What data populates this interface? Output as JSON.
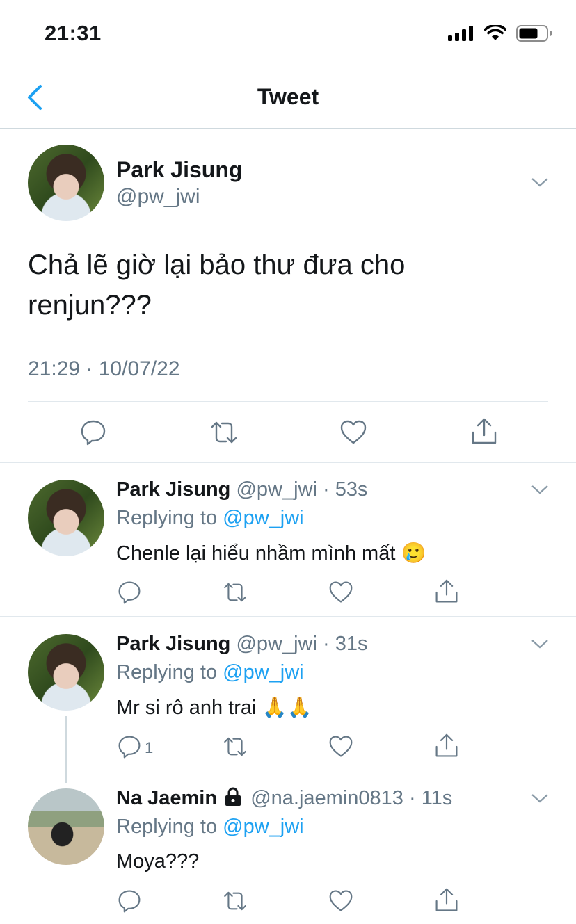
{
  "status_bar": {
    "time": "21:31",
    "signal_icon": "signal-bars-icon",
    "wifi_icon": "wifi-icon",
    "battery_icon": "battery-icon"
  },
  "nav": {
    "title": "Tweet",
    "back_icon": "chevron-left-icon"
  },
  "main_tweet": {
    "display_name": "Park Jisung",
    "handle": "@pw_jwi",
    "text_line1": "Chả lẽ giờ lại bảo thư đưa cho",
    "text_line2": "renjun???",
    "timestamp": "21:29 · 10/07/22"
  },
  "replies": [
    {
      "display_name": "Park Jisung",
      "handle": "@pw_jwi",
      "time": "53s",
      "replying_label": "Replying to",
      "replying_to": "@pw_jwi",
      "text": "Chenle lại hiểu nhầm mình mất 🥲",
      "reply_count": ""
    },
    {
      "display_name": "Park Jisung",
      "handle": "@pw_jwi",
      "time": "31s",
      "replying_label": "Replying to",
      "replying_to": "@pw_jwi",
      "text": "Mr si rô anh trai 🙏🙏",
      "reply_count": "1"
    },
    {
      "display_name": "Na Jaemin",
      "handle": "@na.jaemin0813",
      "time": "11s",
      "replying_label": "Replying to",
      "replying_to": "@pw_jwi",
      "text": "Moya???",
      "reply_count": "",
      "protected_icon": "lock-icon"
    }
  ],
  "colors": {
    "link": "#1da1f2",
    "secondary": "#657786",
    "text": "#14171a"
  }
}
